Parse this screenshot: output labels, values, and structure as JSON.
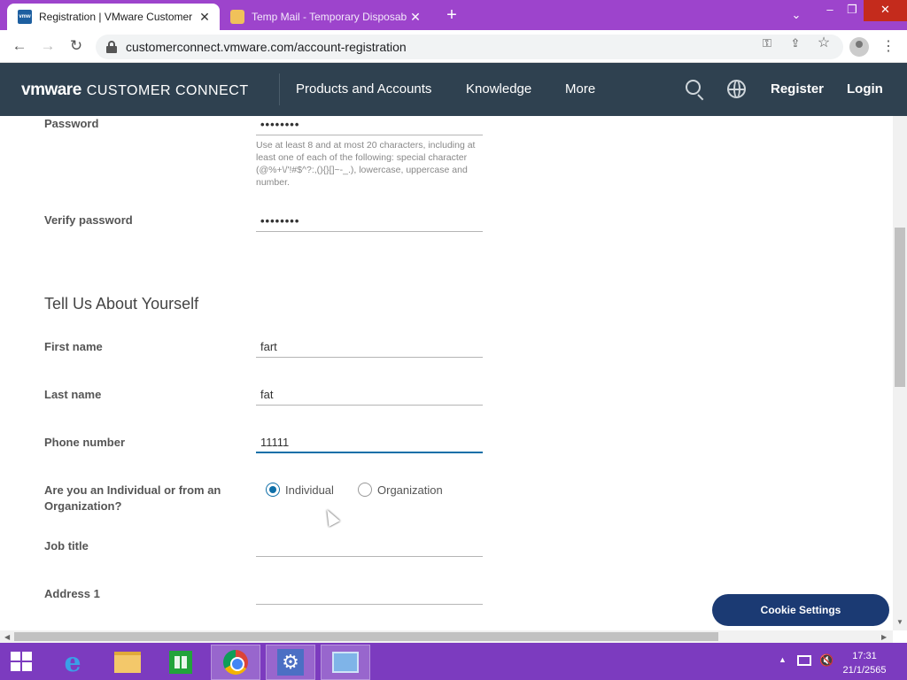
{
  "browser": {
    "tabs": [
      {
        "title": "Registration | VMware Customer",
        "favicon": "vmware-favicon",
        "active": true
      },
      {
        "title": "Temp Mail - Temporary Disposab",
        "favicon": "mail-favicon",
        "active": false
      }
    ],
    "new_tab_symbol": "+",
    "url": "customerconnect.vmware.com/account-registration"
  },
  "site": {
    "logo_vm": "vmware",
    "logo_product": "CUSTOMER CONNECT",
    "nav": [
      "Products and Accounts",
      "Knowledge",
      "More"
    ],
    "register": "Register",
    "login": "Login"
  },
  "form": {
    "password_label": "Password",
    "password_value": "••••••••",
    "password_hint": "Use at least 8 and at most 20 characters, including at least one of each of the following: special character (@%+\\/'!#$^?:,(){}[]~-_.), lowercase, uppercase and number.",
    "verify_label": "Verify password",
    "verify_value": "••••••••",
    "section_title": "Tell Us About Yourself",
    "first_name_label": "First name",
    "first_name_value": "fart",
    "last_name_label": "Last name",
    "last_name_value": "fat",
    "phone_label": "Phone number",
    "phone_value": "11111",
    "type_question": "Are you an Individual or from an Organization?",
    "type_options": [
      "Individual",
      "Organization"
    ],
    "type_selected": "Individual",
    "job_title_label": "Job title",
    "job_title_value": "",
    "address1_label": "Address 1",
    "address1_value": ""
  },
  "cookie_button": "Cookie Settings",
  "taskbar": {
    "time": "17:31",
    "date": "21/1/2565"
  },
  "colors": {
    "tab_strip": "#9d44cc",
    "site_header": "#2f4150",
    "accent": "#0f6fa8",
    "cookie_button": "#1b3a73",
    "taskbar": "#7c3bbf"
  }
}
